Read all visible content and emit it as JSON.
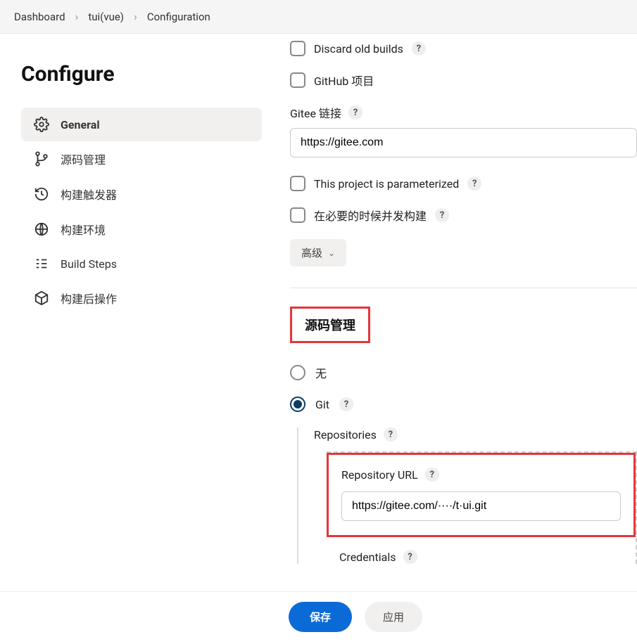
{
  "breadcrumb": {
    "dashboard": "Dashboard",
    "project": "tui(vue)",
    "page": "Configuration"
  },
  "sidebar": {
    "title": "Configure",
    "items": [
      {
        "label": "General"
      },
      {
        "label": "源码管理"
      },
      {
        "label": "构建触发器"
      },
      {
        "label": "构建环境"
      },
      {
        "label": "Build Steps"
      },
      {
        "label": "构建后操作"
      }
    ]
  },
  "form": {
    "discard_label": "Discard old builds",
    "github_label": "GitHub 项目",
    "gitee_label": "Gitee 链接",
    "gitee_value": "https://gitee.com",
    "param_label": "This project is parameterized",
    "concurrent_label": "在必要的时候并发构建",
    "advanced_label": "高级"
  },
  "scm": {
    "title": "源码管理",
    "none_label": "无",
    "git_label": "Git",
    "repos_label": "Repositories",
    "repo_url_label": "Repository URL",
    "repo_url_value": "https://gitee.com/····/t·ui.git",
    "credentials_label": "Credentials"
  },
  "footer": {
    "save": "保存",
    "apply": "应用"
  }
}
